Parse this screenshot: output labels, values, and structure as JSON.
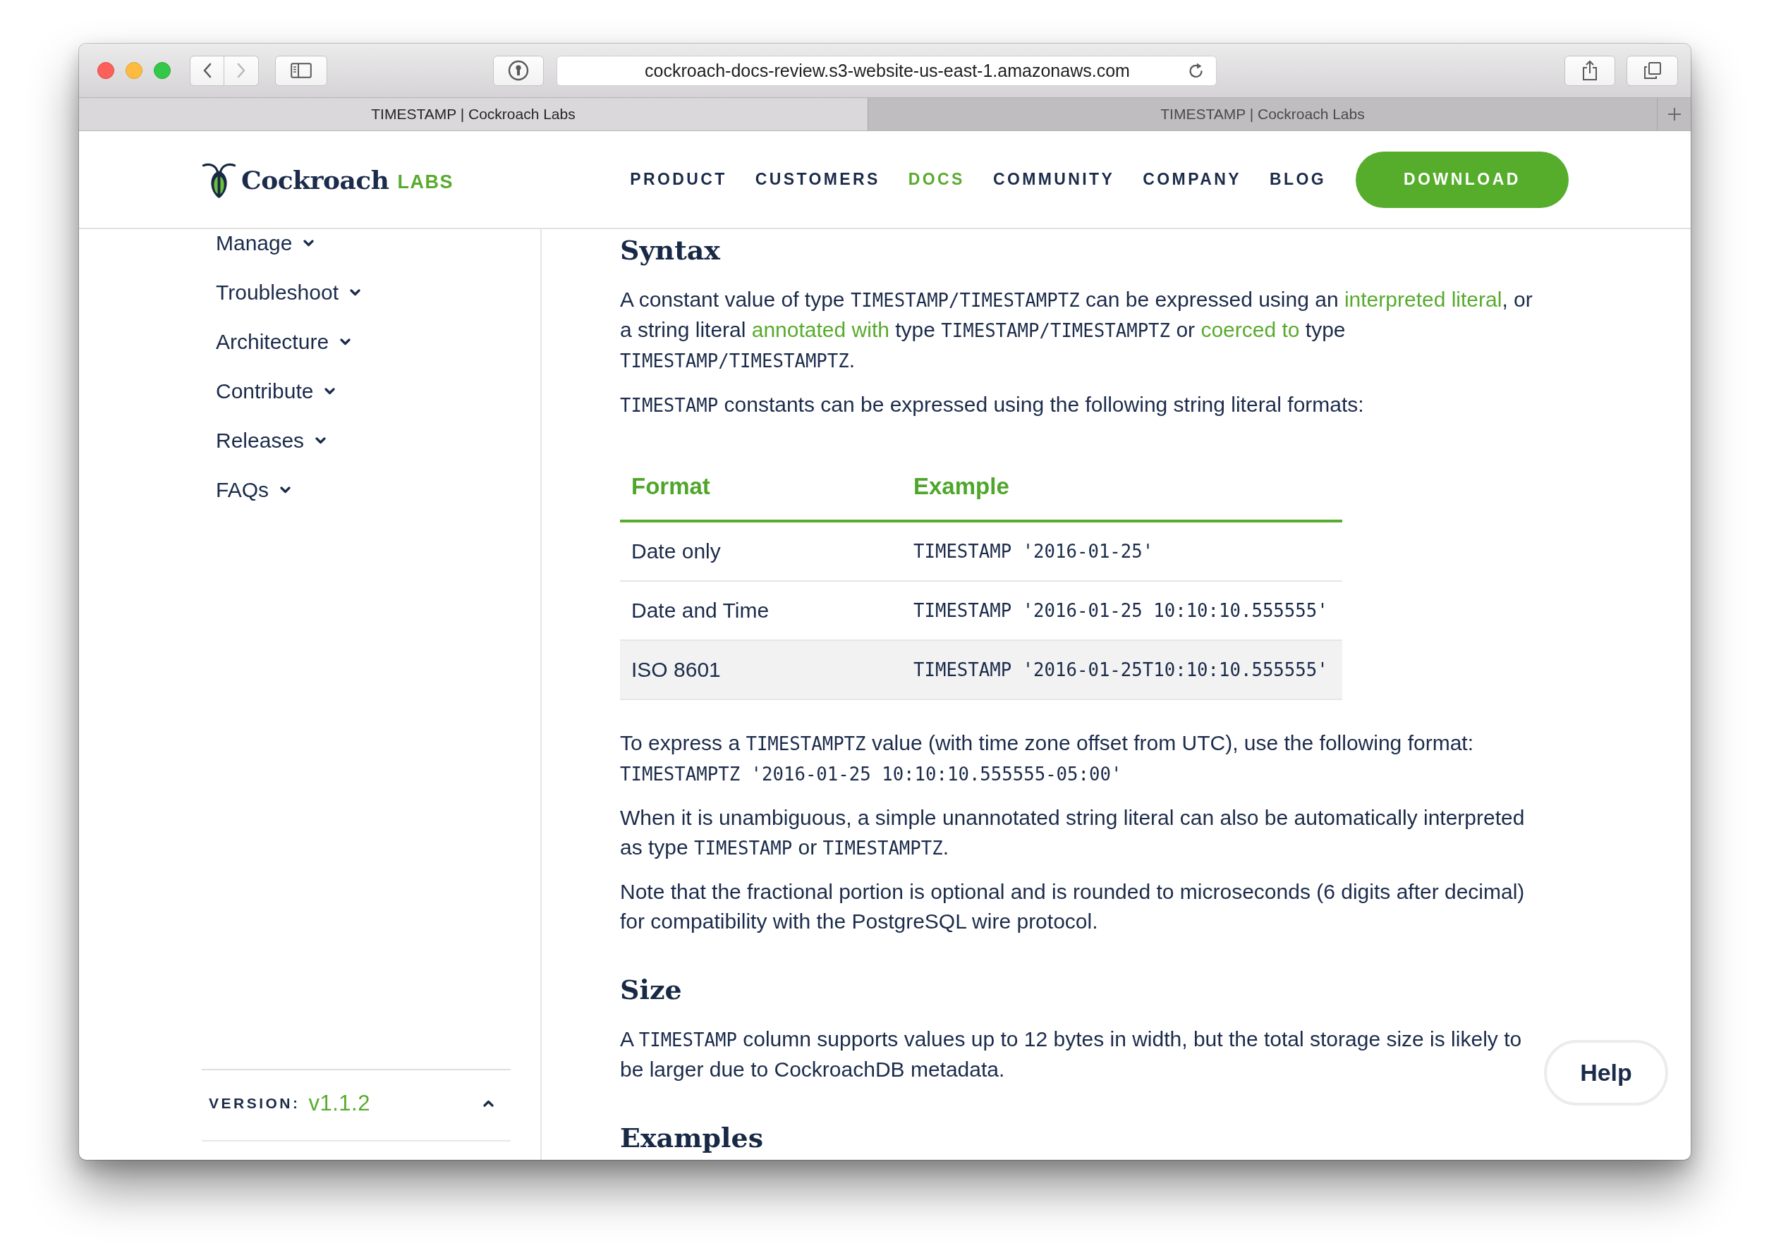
{
  "browser": {
    "nav_buttons": [
      {
        "kind": "back",
        "disabled": false
      },
      {
        "kind": "forward",
        "disabled": true
      }
    ],
    "url": "cockroach-docs-review.s3-website-us-east-1.amazonaws.com",
    "tabs": [
      {
        "title": "TIMESTAMP | Cockroach Labs",
        "selected": true
      },
      {
        "title": "TIMESTAMP | Cockroach Labs",
        "selected": false
      }
    ]
  },
  "header": {
    "logo": {
      "name": "Cockroach",
      "suffix": "LABS"
    },
    "nav": [
      {
        "label": "PRODUCT",
        "selected": false
      },
      {
        "label": "CUSTOMERS",
        "selected": false
      },
      {
        "label": "DOCS",
        "selected": true
      },
      {
        "label": "COMMUNITY",
        "selected": false
      },
      {
        "label": "COMPANY",
        "selected": false
      },
      {
        "label": "BLOG",
        "selected": false
      }
    ],
    "download_button": "DOWNLOAD"
  },
  "sidebar": {
    "items": [
      {
        "label": "Manage",
        "expanded": false
      },
      {
        "label": "Troubleshoot",
        "expanded": false
      },
      {
        "label": "Architecture",
        "expanded": false
      },
      {
        "label": "Contribute",
        "expanded": false
      },
      {
        "label": "Releases",
        "expanded": false
      },
      {
        "label": "FAQs",
        "expanded": false
      }
    ],
    "version": {
      "label": "VERSION:",
      "value": "v1.1.2"
    }
  },
  "content": {
    "sections": [
      {
        "heading": "Syntax",
        "blocks": [
          {
            "kind": "paragraph",
            "segments": [
              {
                "kind": "text",
                "text": "A constant value of type "
              },
              {
                "kind": "code",
                "text": "TIMESTAMP/TIMESTAMPTZ"
              },
              {
                "kind": "text",
                "text": " can be expressed using an "
              },
              {
                "kind": "link",
                "text": "interpreted literal"
              },
              {
                "kind": "text",
                "text": ", or a string literal "
              },
              {
                "kind": "link",
                "text": "annotated with"
              },
              {
                "kind": "text",
                "text": " type "
              },
              {
                "kind": "code",
                "text": "TIMESTAMP/TIMESTAMPTZ"
              },
              {
                "kind": "text",
                "text": " or "
              },
              {
                "kind": "link",
                "text": "coerced to"
              },
              {
                "kind": "text",
                "text": " type "
              },
              {
                "kind": "code",
                "text": "TIMESTAMP/TIMESTAMPTZ"
              },
              {
                "kind": "text",
                "text": "."
              }
            ]
          },
          {
            "kind": "paragraph",
            "segments": [
              {
                "kind": "code",
                "text": "TIMESTAMP"
              },
              {
                "kind": "text",
                "text": " constants can be expressed using the following string literal formats:"
              }
            ]
          },
          {
            "kind": "table",
            "columns": [
              {
                "label": "Format",
                "kind": "text"
              },
              {
                "label": "Example",
                "kind": "code"
              }
            ],
            "rows": [
              {
                "cells": [
                  "Date only",
                  "TIMESTAMP '2016-01-25'"
                ],
                "highlighted": false
              },
              {
                "cells": [
                  "Date and Time",
                  "TIMESTAMP '2016-01-25 10:10:10.555555'"
                ],
                "highlighted": false
              },
              {
                "cells": [
                  "ISO 8601",
                  "TIMESTAMP '2016-01-25T10:10:10.555555'"
                ],
                "highlighted": true
              }
            ]
          },
          {
            "kind": "paragraph",
            "segments": [
              {
                "kind": "text",
                "text": "To express a "
              },
              {
                "kind": "code",
                "text": "TIMESTAMPTZ"
              },
              {
                "kind": "text",
                "text": " value (with time zone offset from UTC), use the following format: "
              },
              {
                "kind": "code",
                "text": "TIMESTAMPTZ '2016-01-25 10:10:10.555555-05:00'"
              }
            ]
          },
          {
            "kind": "paragraph",
            "segments": [
              {
                "kind": "text",
                "text": "When it is unambiguous, a simple unannotated string literal can also be automatically interpreted as type "
              },
              {
                "kind": "code",
                "text": "TIMESTAMP"
              },
              {
                "kind": "text",
                "text": " or "
              },
              {
                "kind": "code",
                "text": "TIMESTAMPTZ"
              },
              {
                "kind": "text",
                "text": "."
              }
            ]
          },
          {
            "kind": "paragraph",
            "segments": [
              {
                "kind": "text",
                "text": "Note that the fractional portion is optional and is rounded to microseconds (6 digits after decimal) for compatibility with the PostgreSQL wire protocol."
              }
            ]
          }
        ]
      },
      {
        "heading": "Size",
        "blocks": [
          {
            "kind": "paragraph",
            "segments": [
              {
                "kind": "text",
                "text": "A "
              },
              {
                "kind": "code",
                "text": "TIMESTAMP"
              },
              {
                "kind": "text",
                "text": " column supports values up to 12 bytes in width, but the total storage size is likely to be larger due to CockroachDB metadata."
              }
            ]
          }
        ]
      },
      {
        "heading": "Examples"
      }
    ]
  },
  "help_button": "Help"
}
